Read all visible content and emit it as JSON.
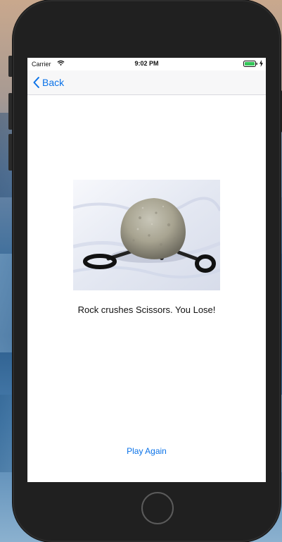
{
  "status_bar": {
    "carrier": "Carrier",
    "time": "9:02 PM",
    "wifi_icon": "wifi-icon",
    "battery_icon": "battery-icon",
    "charging_icon": "bolt-icon",
    "battery_color": "#34c759"
  },
  "nav_bar": {
    "back_label": "Back",
    "back_icon": "chevron-left-icon",
    "accent_color": "#0a72e8"
  },
  "content": {
    "result_text": "Rock crushes Scissors. You Lose!",
    "play_again_label": "Play Again"
  }
}
